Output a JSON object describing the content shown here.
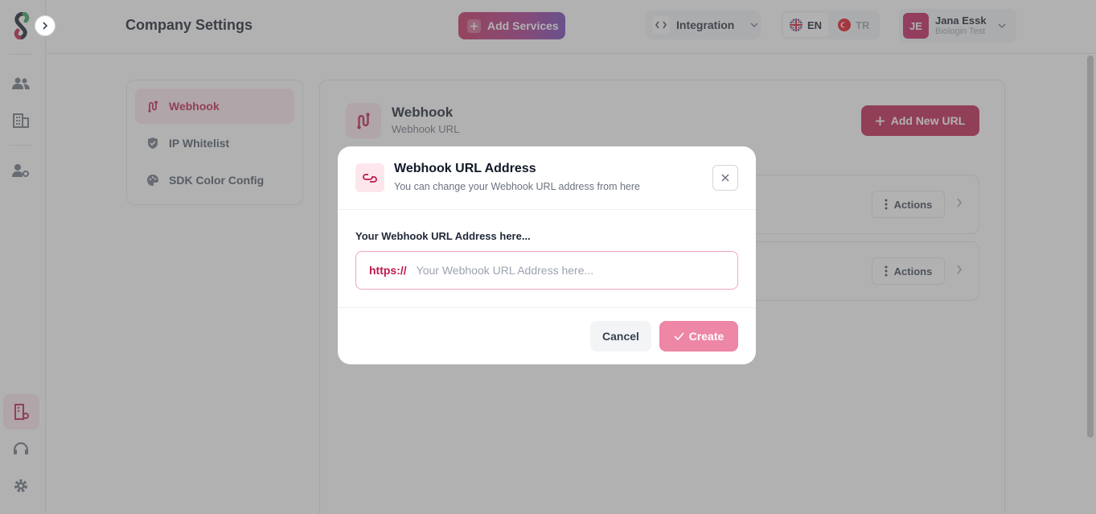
{
  "header": {
    "title": "Company Settings",
    "add_services_label": "Add Services",
    "integration_label": "Integration",
    "languages": [
      {
        "code": "EN",
        "selected": true
      },
      {
        "code": "TR",
        "selected": false
      }
    ],
    "user": {
      "initials": "JE",
      "name": "Jana Essk",
      "company": "Biologin Test"
    }
  },
  "settings_nav": {
    "items": [
      {
        "label": "Webhook",
        "icon": "webhook-icon",
        "active": true
      },
      {
        "label": "IP Whitelist",
        "icon": "shield-check-icon",
        "active": false
      },
      {
        "label": "SDK Color Config",
        "icon": "palette-icon",
        "active": false
      }
    ]
  },
  "main": {
    "title": "Webhook",
    "subtitle": "Webhook URL",
    "add_url_label": "Add New URL",
    "rows": [
      {
        "actions_label": "Actions"
      },
      {
        "actions_label": "Actions"
      }
    ]
  },
  "modal": {
    "title": "Webhook URL Address",
    "subtitle": "You can change your Webhook URL address from here",
    "field_label": "Your Webhook URL Address here...",
    "prefix": "https://",
    "input_value": "",
    "input_placeholder": "Your Webhook URL Address here...",
    "cancel_label": "Cancel",
    "create_label": "Create"
  },
  "colors": {
    "brand": "#be1a4b",
    "brand_light": "#fde7ec",
    "create_disabled": "#ee86a5"
  }
}
